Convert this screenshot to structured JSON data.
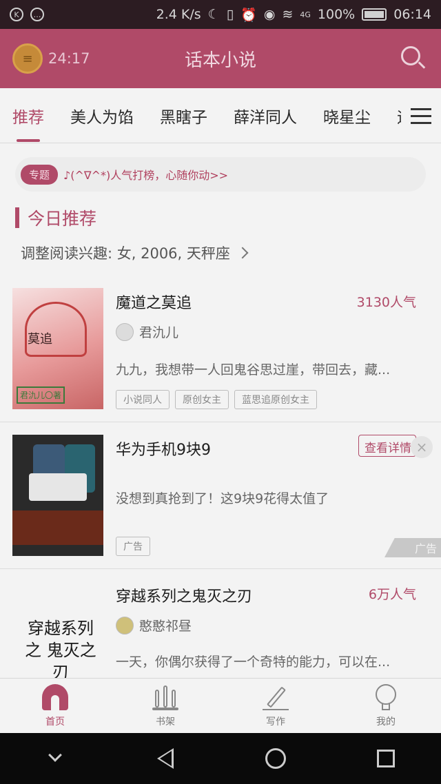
{
  "status_bar": {
    "network_speed": "2.4 K/s",
    "signal_label": "4G",
    "battery": "100%",
    "time": "06:14"
  },
  "header": {
    "timer": "24:17",
    "title": "话本小说"
  },
  "tabs": [
    "推荐",
    "美人为馅",
    "黑瞎子",
    "薛洋同人",
    "晓星尘",
    "迪"
  ],
  "topic": {
    "badge": "专题",
    "text": "♪(^∇^*)人气打榜，心随你动>>"
  },
  "section": {
    "title": "今日推荐",
    "interest": "调整阅读兴趣: 女, 2006, 天秤座"
  },
  "books": [
    {
      "title": "魔道之莫追",
      "popularity": "3130人气",
      "author": "君氿儿",
      "desc": "九九，我想带一人回鬼谷思过崖，带回去，藏...",
      "tags": [
        "小说同人",
        "原创女主",
        "蓝思追原创女主"
      ],
      "cover_title": "莫追",
      "cover_sign": "君氿儿〇著"
    },
    {
      "title": "华为手机9块9",
      "detail_button": "查看详情",
      "desc": "没想到真抢到了！这9块9花得太值了",
      "tag": "广告",
      "ad_mark": "广告"
    },
    {
      "title": "穿越系列之鬼灭之刃",
      "popularity": "6万人气",
      "author": "憨憨祁昼",
      "desc": "一天，你偶尔获得了一个奇特的能力，可以在...",
      "cover_text": "穿越系列 之 鬼灭之刃"
    }
  ],
  "bottom_nav": [
    {
      "label": "首页",
      "icon": "home-icon"
    },
    {
      "label": "书架",
      "icon": "bookshelf-icon"
    },
    {
      "label": "写作",
      "icon": "pen-icon"
    },
    {
      "label": "我的",
      "icon": "profile-icon"
    }
  ],
  "colors": {
    "accent": "#b04a68",
    "header_bg": "#b04a68",
    "background": "#f3f3f3"
  }
}
